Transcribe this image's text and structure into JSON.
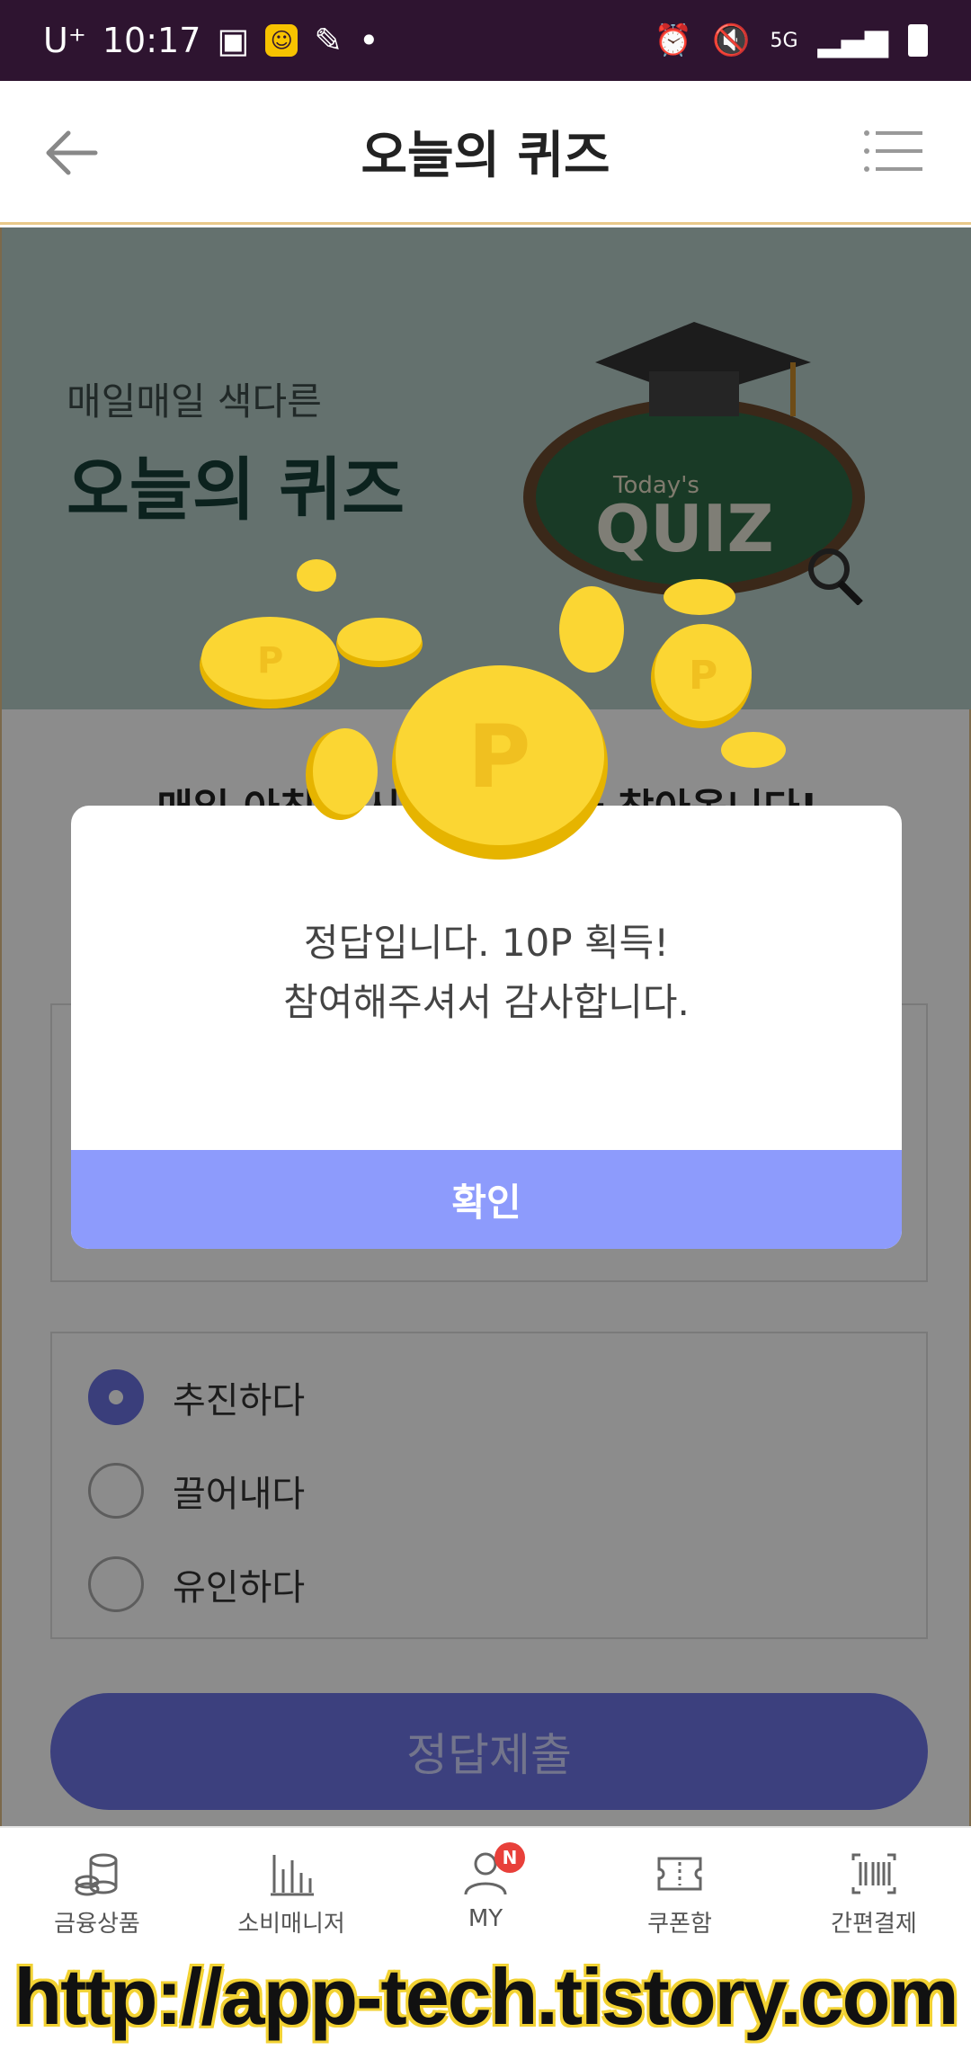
{
  "status_bar": {
    "carrier": "U⁺",
    "time": "10:17",
    "network": "5G"
  },
  "header": {
    "title": "오늘의 퀴즈",
    "back_icon": "arrow-left-icon",
    "menu_icon": "menu-lines-icon"
  },
  "banner": {
    "subtitle": "매일매일 색다른",
    "title": "오늘의 퀴즈",
    "board_label_small": "Today's",
    "board_label_big": "QUIZ"
  },
  "intro": {
    "text": "매일 아침 ○시, ○○○○가 찾아옵니다!"
  },
  "question_options": [
    {
      "label": "추진하다",
      "selected": true
    },
    {
      "label": "끌어내다",
      "selected": false
    },
    {
      "label": "유인하다",
      "selected": false
    }
  ],
  "submit_label": "정답제출",
  "dialog": {
    "line1": "정답입니다. 10P 획득!",
    "line2": "참여해주셔서 감사합니다.",
    "confirm_label": "확인"
  },
  "bottom_nav": [
    {
      "label": "금융상품",
      "icon": "coins-stack-icon"
    },
    {
      "label": "소비매니저",
      "icon": "bar-chart-icon"
    },
    {
      "label": "MY",
      "icon": "person-icon",
      "badge": "N"
    },
    {
      "label": "쿠폰함",
      "icon": "ticket-icon"
    },
    {
      "label": "간편결제",
      "icon": "barcode-icon"
    }
  ],
  "watermark": "http://app-tech.tistory.com",
  "colors": {
    "status_bar": "#2e1430",
    "accent": "#8d9bfc",
    "submit": "#6e76e6",
    "banner_bg": "#b6cec9",
    "coin": "#f9d11a"
  }
}
